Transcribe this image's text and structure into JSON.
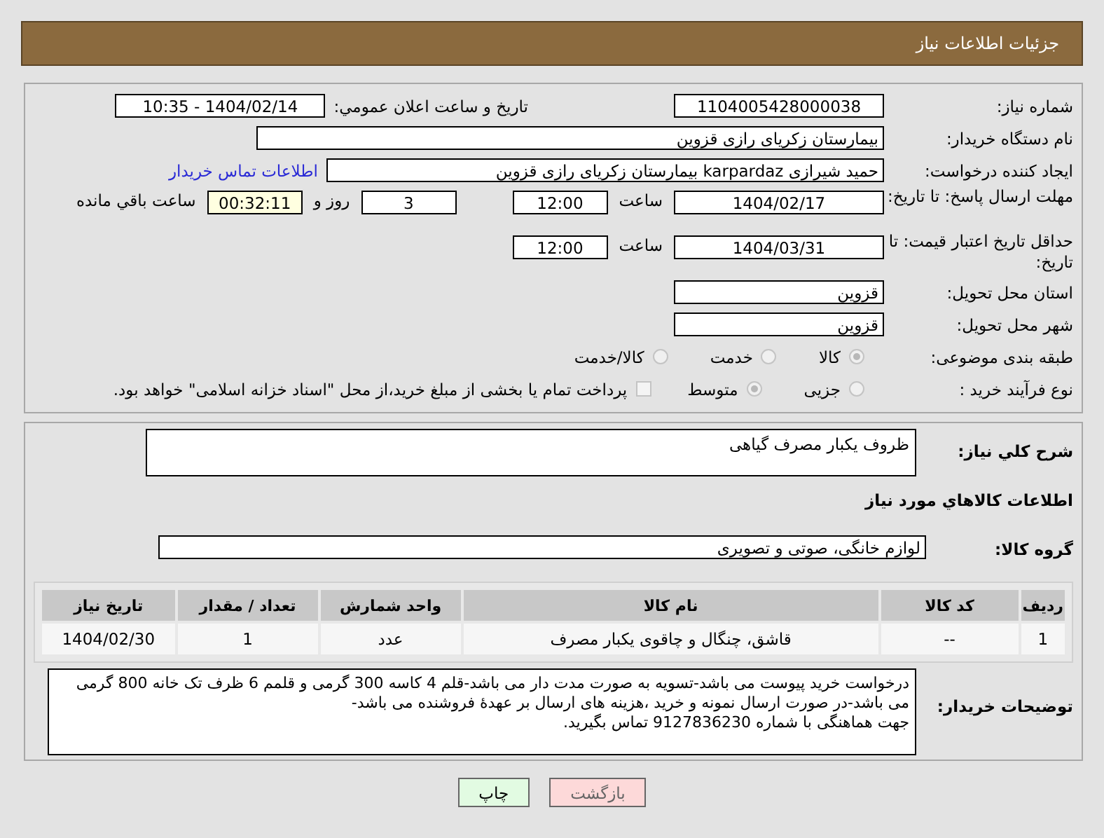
{
  "header": {
    "title": "جزئیات اطلاعات نیاز"
  },
  "need_number": {
    "label": "شماره نیاز:",
    "value": "1104005428000038"
  },
  "announce": {
    "label": "تاریخ و ساعت اعلان عمومي:",
    "value": "1404/02/14 - 10:35"
  },
  "buyer_org": {
    "label": "نام دستگاه خریدار:",
    "value": "بیمارستان زکریای رازی قزوین"
  },
  "creator": {
    "label": "ایجاد کننده درخواست:",
    "value": "حمید شیرازی karpardaz بیمارستان زکریای رازی قزوین",
    "link": "اطلاعات تماس خریدار"
  },
  "reply_deadline": {
    "label": "مهلت ارسال پاسخ: تا تاریخ:",
    "date": "1404/02/17",
    "time_label": "ساعت",
    "time": "12:00",
    "days": "3",
    "days_label": "روز و",
    "remaining": "00:32:11",
    "remaining_label": "ساعت باقي مانده"
  },
  "price_validity": {
    "label": "حداقل تاریخ اعتبار قیمت: تا تاریخ:",
    "date": "1404/03/31",
    "time_label": "ساعت",
    "time": "12:00"
  },
  "province": {
    "label": "استان محل تحویل:",
    "value": "قزوین"
  },
  "city": {
    "label": "شهر محل تحویل:",
    "value": "قزوین"
  },
  "subject_category": {
    "label": "طبقه بندی موضوعی:",
    "options": [
      {
        "label": "کالا",
        "selected": true
      },
      {
        "label": "خدمت",
        "selected": false
      },
      {
        "label": "کالا/خدمت",
        "selected": false
      }
    ]
  },
  "purchase_process": {
    "label": "نوع فرآیند خرید :",
    "options": [
      {
        "label": "جزیی",
        "selected": false
      },
      {
        "label": "متوسط",
        "selected": true
      }
    ],
    "payment": {
      "checked": false,
      "label": "پرداخت تمام یا بخشی از مبلغ خرید،از محل \"اسناد خزانه اسلامی\" خواهد بود."
    }
  },
  "general_description": {
    "label": "شرح کلي نیاز:",
    "value": "ظروف یکبار مصرف گیاهی"
  },
  "goods_heading": "اطلاعات کالاهاي مورد نیاز",
  "goods_group": {
    "label": "گروه کالا:",
    "value": "لوازم خانگی، صوتی و تصویری"
  },
  "table": {
    "columns": [
      "ردیف",
      "کد کالا",
      "نام کالا",
      "واحد شمارش",
      "تعداد / مقدار",
      "تاریخ نیاز"
    ],
    "rows": [
      [
        "1",
        "--",
        "قاشق، چنگال و چاقوی یکبار مصرف",
        "عدد",
        "1",
        "1404/02/30"
      ]
    ]
  },
  "buyer_notes": {
    "label": "توضیحات خریدار:",
    "value": "درخواست خرید پیوست می باشد-تسویه به صورت مدت دار می باشد-قلم 4 کاسه 300 گرمی و قلمم 6 ظرف تک خانه 800 گرمی می باشد-در صورت ارسال نمونه و خرید ،هزینه های ارسال بر عهدهٔ فروشنده می باشد-\nجهت هماهنگی با شماره 9127836230 تماس بگیرید."
  },
  "buttons": [
    {
      "kind": "back",
      "label": "بازگشت"
    },
    {
      "kind": "print",
      "label": "چاپ"
    }
  ]
}
